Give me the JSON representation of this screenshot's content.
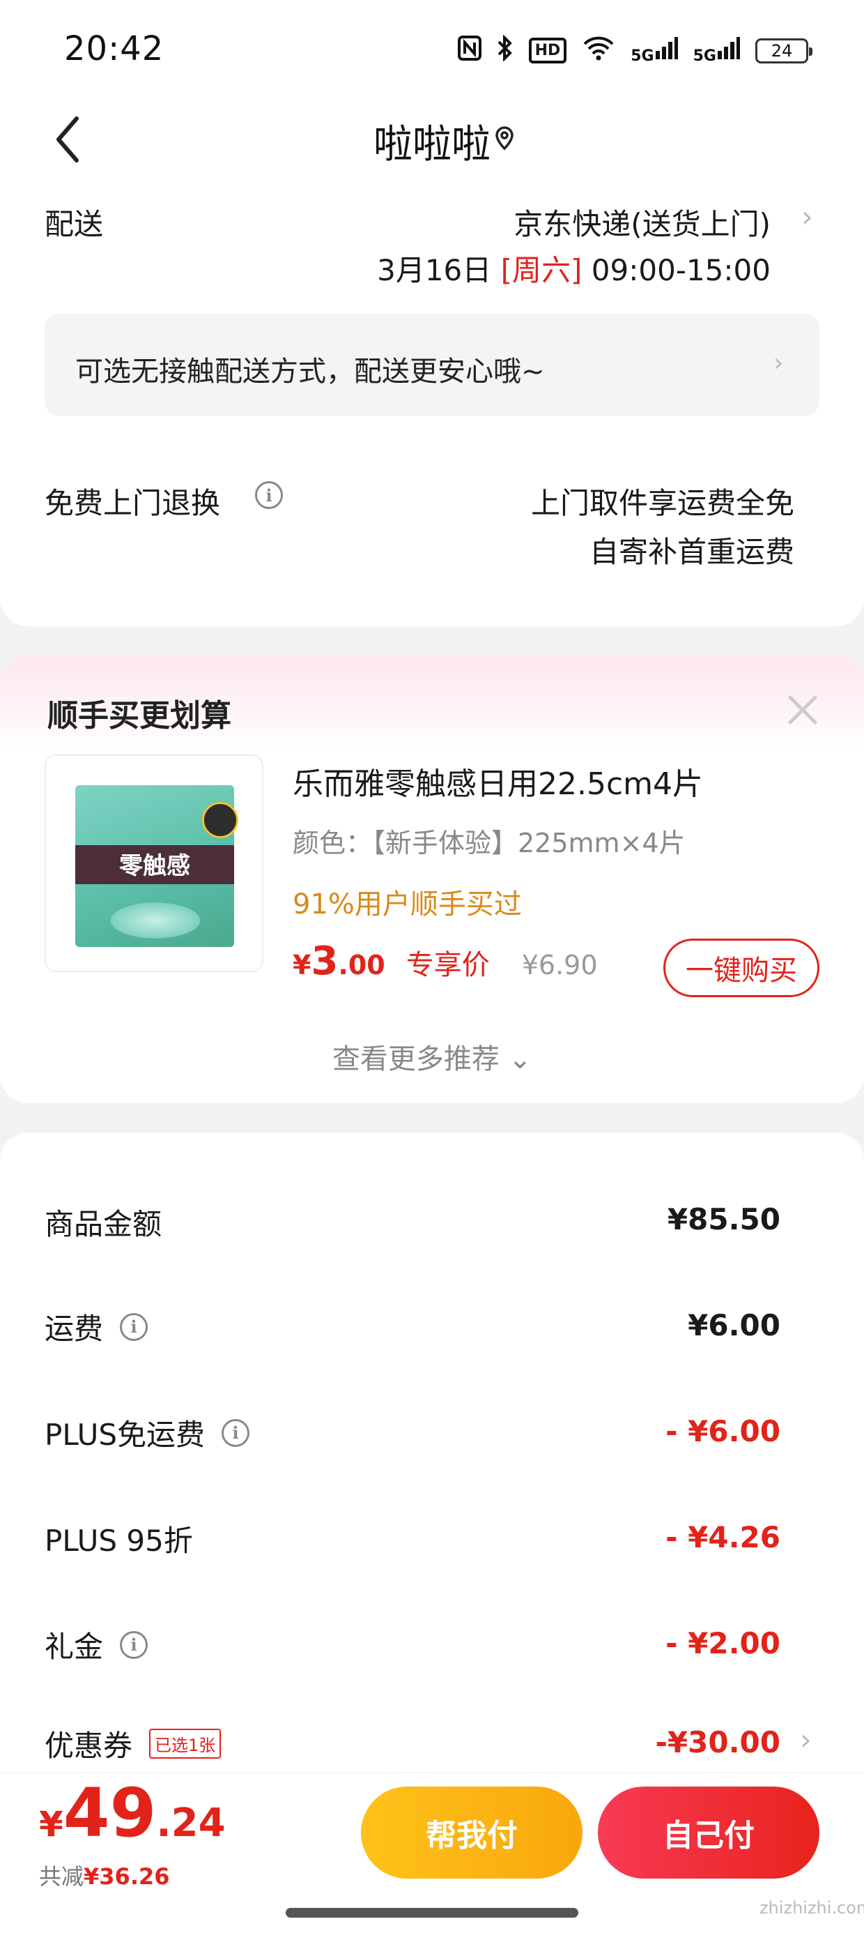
{
  "status_bar": {
    "time": "20:42",
    "icons": [
      "nfc-icon",
      "bluetooth-icon",
      "hd-icon",
      "wifi-icon",
      "signal-5g-1-icon",
      "signal-5g-2-icon",
      "battery-icon"
    ],
    "hd_label": "HD",
    "sig1_label": "5G",
    "sig2_label": "5G",
    "battery": "24"
  },
  "header": {
    "title": "啦啦啦"
  },
  "delivery": {
    "label": "配送",
    "method": "京东快递(送货上门)",
    "date_prefix": "3月16日",
    "date_day": "[周六]",
    "time_window": "09:00-15:00",
    "notice": "可选无接触配送方式，配送更安心哦~"
  },
  "returns": {
    "label": "免费上门退换",
    "line1": "上门取件享运费全免",
    "line2": "自寄补首重运费"
  },
  "recommend": {
    "title": "顺手买更划算",
    "product": {
      "package_text": "零触感",
      "name": "乐而雅零触感日用22.5cm4片",
      "spec": "颜色：【新手体验】225mm×4片",
      "social": "91%用户顺手买过",
      "price_currency": "¥",
      "price_int": "3",
      "price_dec": ".00",
      "price_tag": "专享价",
      "orig_price": "¥6.90",
      "buy_label": "一键购买"
    },
    "see_more": "查看更多推荐 ⌄"
  },
  "summary": {
    "rows": [
      {
        "label": "商品金额",
        "value": "¥85.50"
      },
      {
        "label": "运费",
        "value": "¥6.00"
      },
      {
        "label": "PLUS免运费",
        "value": "- ¥6.00"
      },
      {
        "label": "PLUS 95折",
        "value": "- ¥4.26"
      },
      {
        "label": "礼金",
        "value": "- ¥2.00"
      },
      {
        "label": "优惠券",
        "value": "-¥30.00",
        "badge": "已选1张"
      }
    ]
  },
  "bottom": {
    "total_currency": "¥",
    "total_int": "49",
    "total_dec": ".24",
    "saved_label": "共减",
    "saved_amount": "¥36.26",
    "help_pay": "帮我付",
    "self_pay": "自己付"
  },
  "watermark": "zhizhizhi.com",
  "colors": {
    "accent_red": "#e2231a",
    "social_orange": "#d98a1a",
    "help_pay_yellow": "#ffc21a"
  }
}
